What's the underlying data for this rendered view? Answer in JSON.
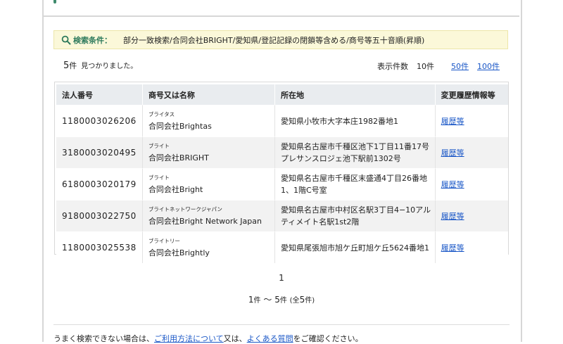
{
  "criteria": {
    "label": "検索条件：",
    "value": "部分一致検索/合同会社BRIGHT/愛知県/登記記録の閉鎖等含める/商号等五十音順(昇順)"
  },
  "results": {
    "count": "5",
    "count_unit": "件",
    "message": "見つかりました。",
    "per_page_label": "表示件数",
    "per_page_current": "10件",
    "per_page_options": [
      "50件",
      "100件"
    ]
  },
  "table": {
    "headers": [
      "法人番号",
      "商号又は名称",
      "所在地",
      "変更履歴情報等"
    ],
    "rows": [
      {
        "number": "1180003026206",
        "kana": "ブライタス",
        "name": "合同会社Brightas",
        "address": "愛知県小牧市大字本庄1982番地1",
        "history": "履歴等"
      },
      {
        "number": "3180003020495",
        "kana": "ブライト",
        "name": "合同会社BRIGHT",
        "address": "愛知県名古屋市千種区池下1丁目11番17号プレサンスロジェ池下駅前1302号",
        "history": "履歴等"
      },
      {
        "number": "6180003020179",
        "kana": "ブライト",
        "name": "合同会社Bright",
        "address": "愛知県名古屋市千種区末盛通4丁目26番地1、1階C号室",
        "history": "履歴等"
      },
      {
        "number": "9180003022750",
        "kana": "ブライトネットワークジャパン",
        "name": "合同会社Bright Network Japan",
        "address": "愛知県名古屋市中村区名駅3丁目4−10アルティメイト名駅1st2階",
        "history": "履歴等"
      },
      {
        "number": "1180003025538",
        "kana": "ブライトリー",
        "name": "合同会社Brightly",
        "address": "愛知県尾張旭市旭ケ丘町旭ケ丘5624番地1",
        "history": "履歴等"
      }
    ]
  },
  "pagination": {
    "current_page": "1",
    "range_from": "1",
    "range_to": "5",
    "total": "5",
    "unit": "件",
    "tilde": "～",
    "total_prefix": "(全",
    "total_suffix": ")"
  },
  "help": {
    "prefix": "うまく検索できない場合は、",
    "link1": "ご利用方法について",
    "mid": "又は、",
    "link2": "よくある質問",
    "suffix": "をご確認ください。"
  },
  "colors": {
    "accent_green": "#2e7a5c",
    "link_blue": "#1a57c7",
    "criteria_bg": "#fbf8d9",
    "header_bg": "#e9ecef"
  }
}
